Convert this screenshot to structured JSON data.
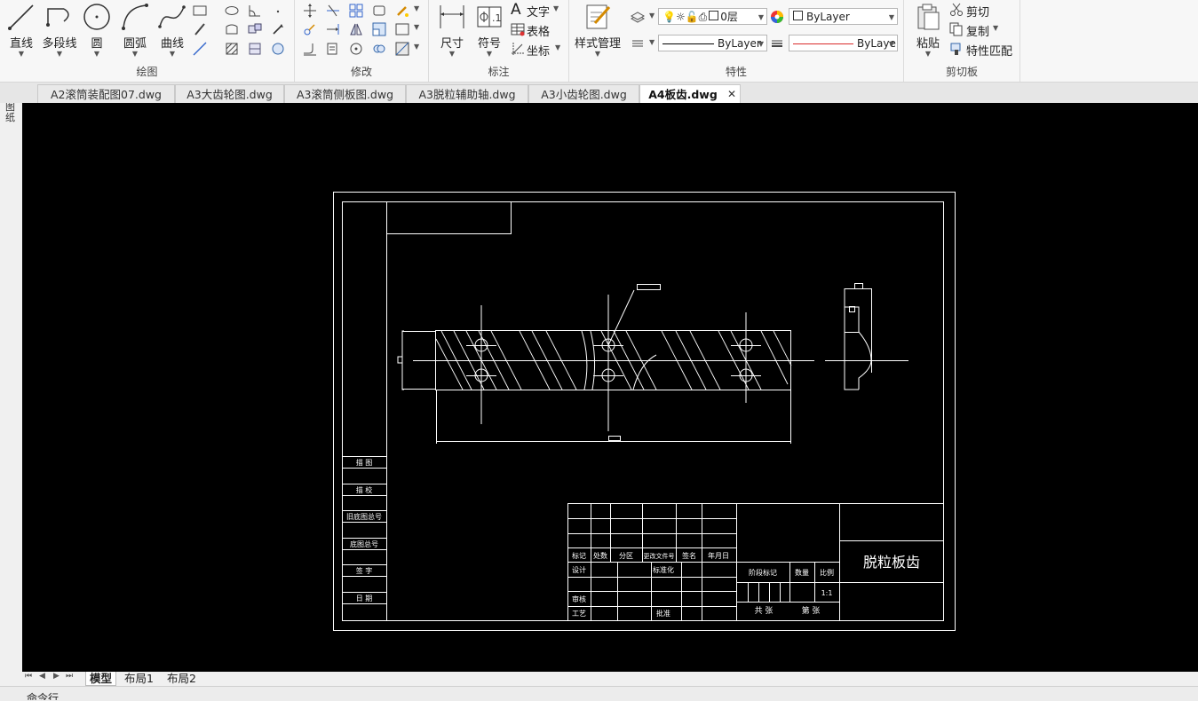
{
  "ribbon": {
    "draw": {
      "label": "绘图",
      "line": "直线",
      "polyline": "多段线",
      "circle": "圆",
      "arc": "圆弧",
      "spline": "曲线"
    },
    "modify": {
      "label": "修改"
    },
    "annotate": {
      "label": "标注",
      "dimension": "尺寸",
      "symbol": "符号",
      "text": "文字",
      "table": "表格",
      "coordinate": "坐标"
    },
    "properties": {
      "label": "特性",
      "style_manager": "样式管理",
      "layer": "0层",
      "color": "ByLayer",
      "linetype": "ByLayer",
      "lineweight": "ByLaye"
    },
    "clipboard": {
      "label": "剪切板",
      "paste": "粘贴",
      "cut": "剪切",
      "copy": "复制",
      "match": "特性匹配"
    }
  },
  "tabs": [
    {
      "label": "A2滚筒装配图07.dwg"
    },
    {
      "label": "A3大齿轮图.dwg"
    },
    {
      "label": "A3滚筒侧板图.dwg"
    },
    {
      "label": "A3脱粒辅助轴.dwg"
    },
    {
      "label": "A3小齿轮图.dwg"
    },
    {
      "label": "A4板齿.dwg"
    }
  ],
  "side_label": "图纸",
  "layout_tabs": [
    "模型",
    "布局1",
    "布局2"
  ],
  "command_label": "命令行",
  "drawing": {
    "part_name": "脱粒板齿",
    "scale": "1:1",
    "left_column": [
      "描 图",
      "描 校",
      "旧底图总号",
      "底图总号",
      "签 字",
      "日 期"
    ],
    "header_row": [
      "标记",
      "处数",
      "分区",
      "更改文件号",
      "签名",
      "年月日"
    ],
    "design": "设计",
    "standardize": "标准化",
    "review": "审核",
    "process": "工艺",
    "approve": "批准",
    "stage_mark": "阶段标记",
    "weight": "数量",
    "ratio": "比例",
    "total_sheets": "共   张",
    "sheet_no": "第   张"
  },
  "colors": {
    "canvas": "#000000",
    "draw": "#ffffff",
    "lineweight_red": "#d92b2b"
  }
}
